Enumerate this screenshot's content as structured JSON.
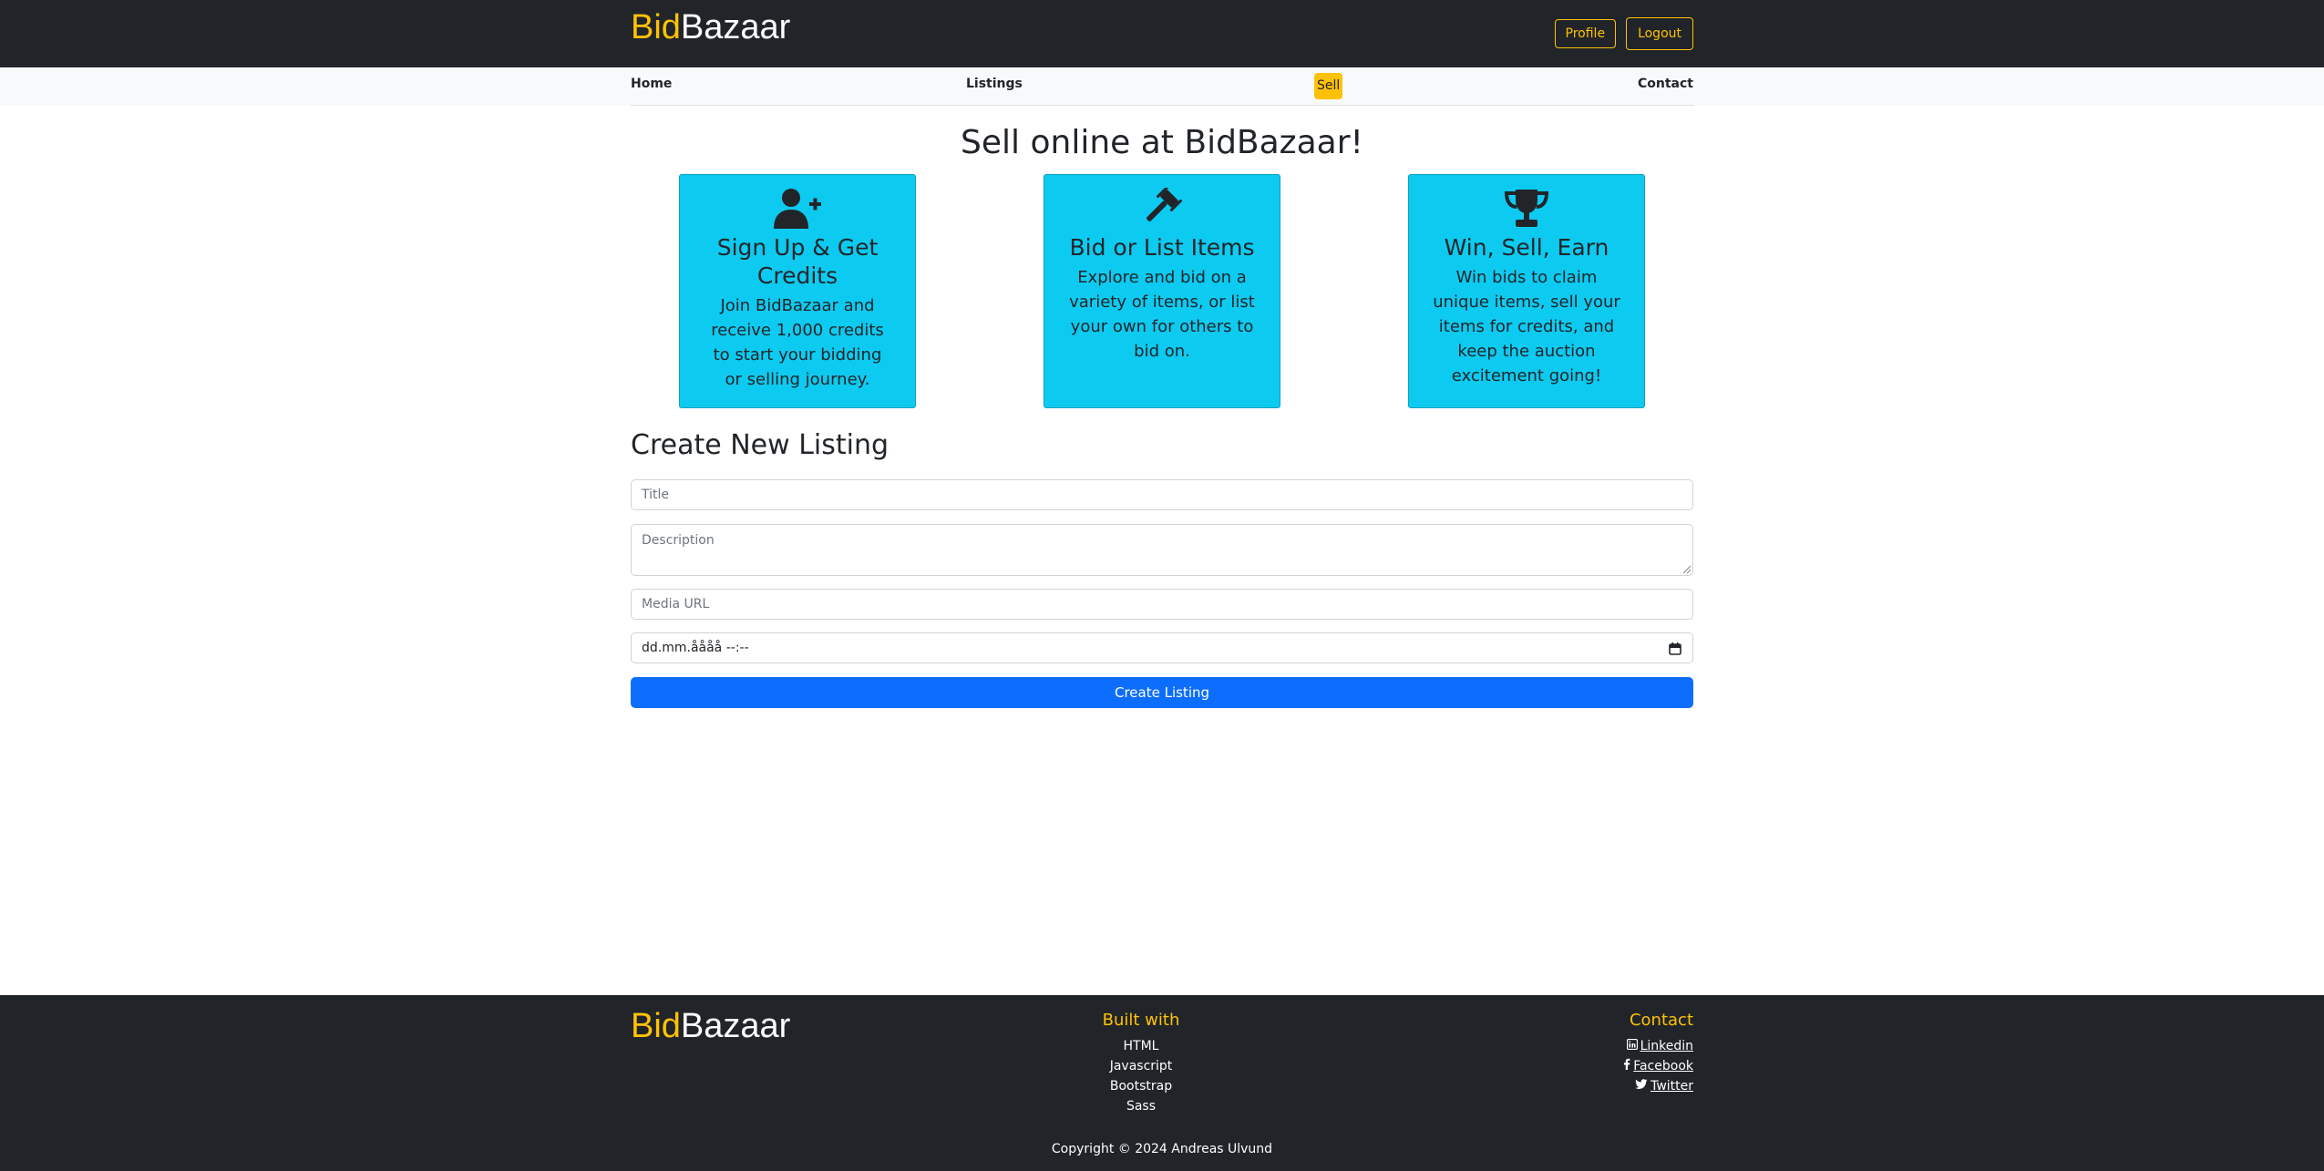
{
  "header": {
    "brand_part1": "Bid",
    "brand_part2": "Bazaar",
    "profile_label": "Profile",
    "logout_label": "Logout"
  },
  "nav": {
    "home": "Home",
    "listings": "Listings",
    "sell": "Sell",
    "contact": "Contact"
  },
  "main": {
    "heading": "Sell online at BidBazaar!",
    "cards": [
      {
        "icon": "user-plus-icon",
        "title": "Sign Up & Get Credits",
        "text": "Join BidBazaar and receive 1,000 credits to start your bidding or selling journey."
      },
      {
        "icon": "gavel-icon",
        "title": "Bid or List Items",
        "text": "Explore and bid on a variety of items, or list your own for others to bid on."
      },
      {
        "icon": "trophy-icon",
        "title": "Win, Sell, Earn",
        "text": "Win bids to claim unique items, sell your items for credits, and keep the auction excitement going!"
      }
    ]
  },
  "form": {
    "title": "Create New Listing",
    "title_placeholder": "Title",
    "description_placeholder": "Description",
    "media_placeholder": "Media URL",
    "date_value": "dd.mm.åååå --:--",
    "submit_label": "Create Listing"
  },
  "footer": {
    "brand_part1": "Bid",
    "brand_part2": "Bazaar",
    "built_with_heading": "Built with",
    "built_with": [
      "HTML",
      "Javascript",
      "Bootstrap",
      "Sass"
    ],
    "contact_heading": "Contact",
    "contact_links": [
      "Linkedin",
      "Facebook",
      "Twitter"
    ],
    "copyright": "Copyright © 2024 Andreas Ulvund"
  },
  "colors": {
    "dark": "#212529",
    "accent": "#ffc107",
    "card": "#0dcaf0",
    "primary": "#0d6efd"
  }
}
